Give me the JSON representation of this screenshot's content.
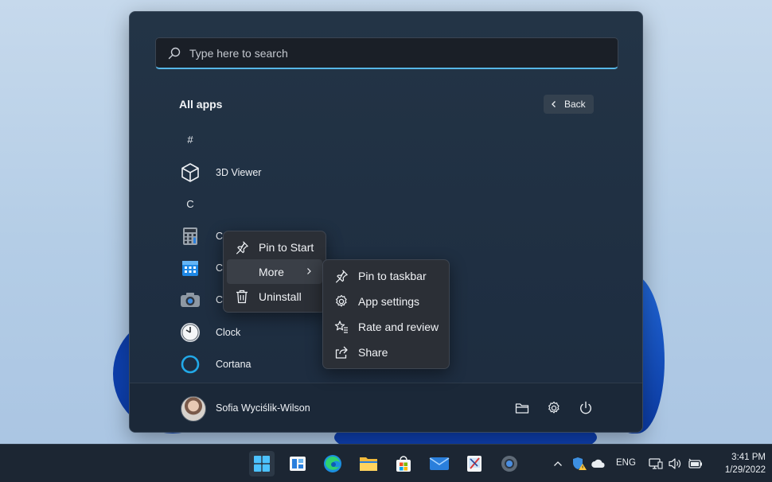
{
  "search": {
    "placeholder": "Type here to search"
  },
  "start": {
    "heading": "All apps",
    "back_label": "Back",
    "groups": [
      {
        "letter": "#",
        "apps": [
          {
            "name": "3D Viewer",
            "icon": "cube-icon"
          }
        ]
      },
      {
        "letter": "C",
        "apps": [
          {
            "name": "Ca",
            "icon": "calculator-icon"
          },
          {
            "name": "Ca",
            "icon": "calendar-icon"
          },
          {
            "name": "Ca",
            "icon": "camera-icon"
          },
          {
            "name": "Clock",
            "icon": "clock-icon"
          },
          {
            "name": "Cortana",
            "icon": "cortana-icon"
          }
        ]
      }
    ],
    "user": {
      "name": "Sofia Wyciślik-Wilson"
    },
    "footer_icons": [
      "folder-icon",
      "settings-icon",
      "power-icon"
    ]
  },
  "context_menu": {
    "items": [
      {
        "label": "Pin to Start",
        "icon": "pin-icon"
      },
      {
        "label": "More",
        "icon": "",
        "submenu": true
      },
      {
        "label": "Uninstall",
        "icon": "trash-icon"
      }
    ]
  },
  "submenu": {
    "items": [
      {
        "label": "Pin to taskbar",
        "icon": "pin-icon"
      },
      {
        "label": "App settings",
        "icon": "gear-icon"
      },
      {
        "label": "Rate and review",
        "icon": "star-list-icon"
      },
      {
        "label": "Share",
        "icon": "share-icon"
      }
    ]
  },
  "taskbar": {
    "apps": [
      "start-icon",
      "widgets-icon",
      "edge-icon",
      "file-explorer-icon",
      "store-icon",
      "mail-icon",
      "snip-icon",
      "settings-icon"
    ],
    "tray": {
      "language": "ENG",
      "time": "3:41 PM",
      "date": "1/29/2022"
    }
  },
  "colors": {
    "accent": "#56b6e6",
    "panel": "#223345",
    "menu": "#2b2f36"
  }
}
